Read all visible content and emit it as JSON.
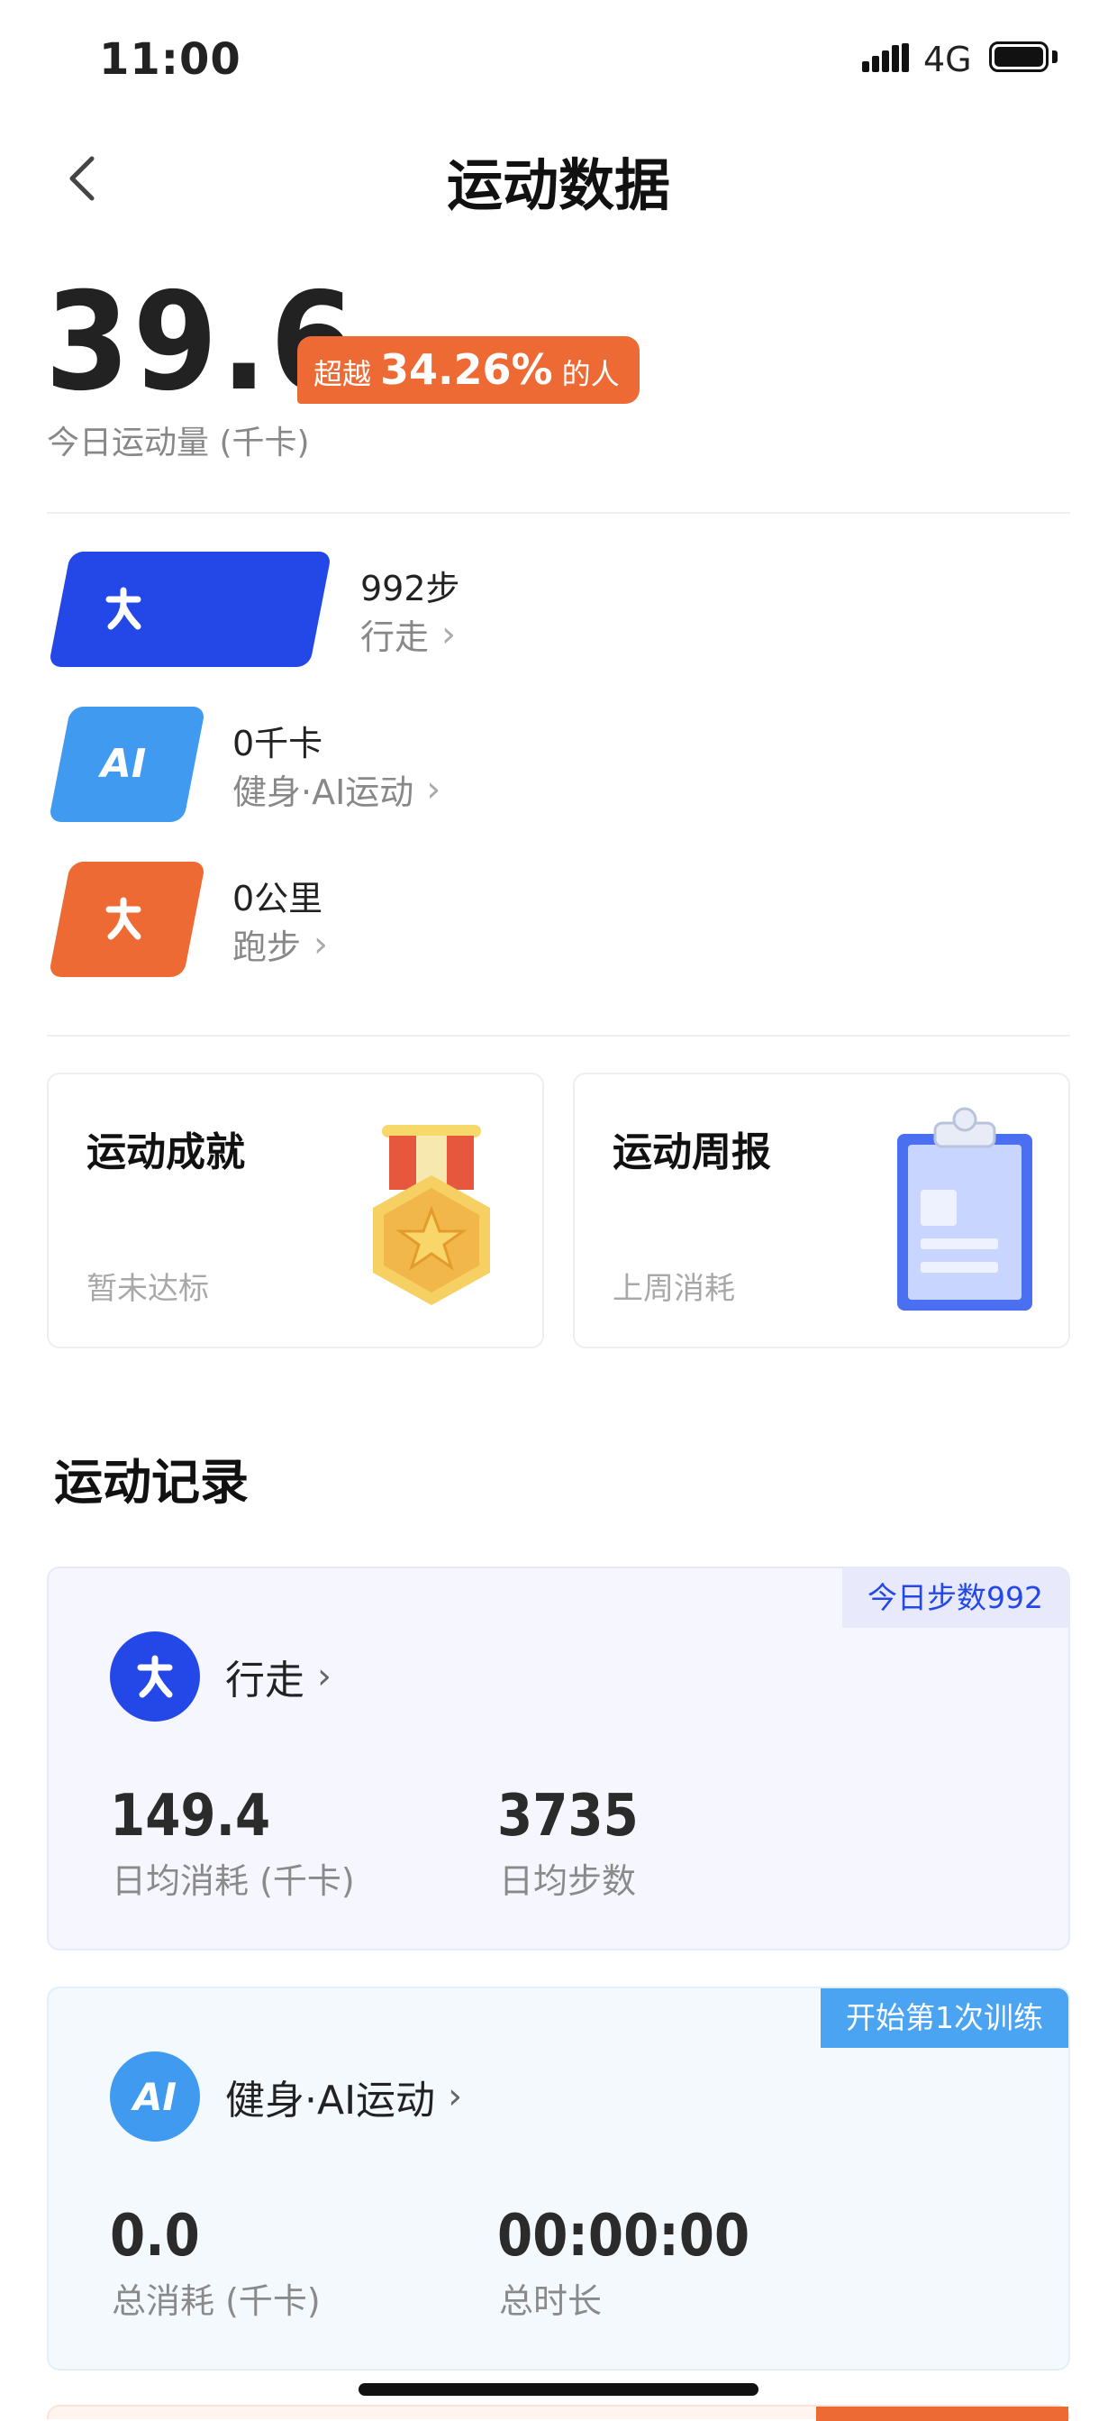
{
  "status_bar": {
    "time": "11:00",
    "network": "4G"
  },
  "nav": {
    "title": "运动数据"
  },
  "summary": {
    "value": "39.6",
    "exceed_prefix": "超越",
    "exceed_percent": "34.26%",
    "exceed_suffix": "的人",
    "label": "今日运动量 (千卡)"
  },
  "activities": [
    {
      "icon_text": "大",
      "value": "992步",
      "label": "行走",
      "color": "#2448e8",
      "bar_fraction": 1.0
    },
    {
      "icon_text": "AI",
      "value": "0千卡",
      "label": "健身·AI运动",
      "color": "#3f9af0",
      "bar_fraction": 0.0
    },
    {
      "icon_text": "大",
      "value": "0公里",
      "label": "跑步",
      "color": "#ee6a34",
      "bar_fraction": 0.0
    }
  ],
  "cards": {
    "achievement": {
      "title": "运动成就",
      "subtitle": "暂未达标",
      "icon": "medal-icon"
    },
    "weekly": {
      "title": "运动周报",
      "subtitle": "上周消耗",
      "icon": "clipboard-icon"
    }
  },
  "records": {
    "title": "运动记录",
    "walk": {
      "badge": "今日步数992",
      "name": "行走",
      "stat1_value": "149.4",
      "stat1_label": "日均消耗 (千卡)",
      "stat2_value": "3735",
      "stat2_label": "日均步数"
    },
    "ai": {
      "badge": "开始第1次训练",
      "name": "健身·AI运动",
      "stat1_value": "0.0",
      "stat1_label": "总消耗 (千卡)",
      "stat2_value": "00:00:00",
      "stat2_label": "总时长"
    }
  },
  "colors": {
    "blue": "#2448e8",
    "light_blue": "#3f9af0",
    "orange": "#ee6a34",
    "walk_card_bg": "#f6f7fe",
    "ai_card_bg": "#f4f9fe"
  }
}
